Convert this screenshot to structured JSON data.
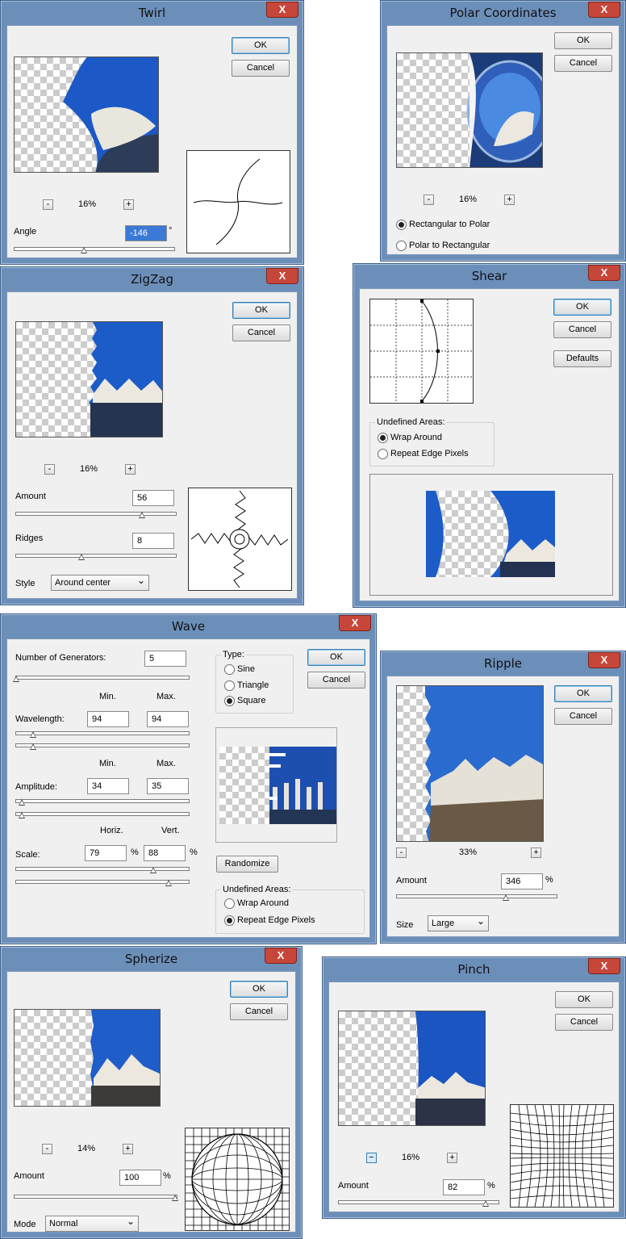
{
  "twirl": {
    "title": "Twirl",
    "ok": "OK",
    "cancel": "Cancel",
    "zoom": "16%",
    "minus": "-",
    "plus": "+",
    "angle_label": "Angle",
    "angle_value": "-146",
    "deg": "°"
  },
  "polar": {
    "title": "Polar Coordinates",
    "ok": "OK",
    "cancel": "Cancel",
    "zoom": "16%",
    "minus": "-",
    "plus": "+",
    "opt1": "Rectangular to Polar",
    "opt2": "Polar to Rectangular"
  },
  "zigzag": {
    "title": "ZigZag",
    "ok": "OK",
    "cancel": "Cancel",
    "zoom": "16%",
    "minus": "-",
    "plus": "+",
    "amount_label": "Amount",
    "amount_value": "56",
    "ridges_label": "Ridges",
    "ridges_value": "8",
    "style_label": "Style",
    "style_value": "Around center"
  },
  "shear": {
    "title": "Shear",
    "ok": "OK",
    "cancel": "Cancel",
    "defaults": "Defaults",
    "group": "Undefined Areas:",
    "opt1": "Wrap Around",
    "opt2": "Repeat Edge Pixels"
  },
  "wave": {
    "title": "Wave",
    "ok": "OK",
    "cancel": "Cancel",
    "gen_label": "Number of Generators:",
    "gen_value": "5",
    "type_label": "Type:",
    "type1": "Sine",
    "type2": "Triangle",
    "type3": "Square",
    "min1": "Min.",
    "max1": "Max.",
    "wl_label": "Wavelength:",
    "wl_min": "94",
    "wl_max": "94",
    "min2": "Min.",
    "max2": "Max.",
    "amp_label": "Amplitude:",
    "amp_min": "34",
    "amp_max": "35",
    "horiz": "Horiz.",
    "vert": "Vert.",
    "scale_label": "Scale:",
    "scale_h": "79",
    "scale_v": "88",
    "pct1": "%",
    "pct2": "%",
    "randomize": "Randomize",
    "group": "Undefined Areas:",
    "opt1": "Wrap Around",
    "opt2": "Repeat Edge Pixels"
  },
  "ripple": {
    "title": "Ripple",
    "ok": "OK",
    "cancel": "Cancel",
    "zoom": "33%",
    "minus": "-",
    "plus": "+",
    "amount_label": "Amount",
    "amount_value": "346",
    "pct": "%",
    "size_label": "Size",
    "size_value": "Large"
  },
  "spherize": {
    "title": "Spherize",
    "ok": "OK",
    "cancel": "Cancel",
    "zoom": "14%",
    "minus": "-",
    "plus": "+",
    "amount_label": "Amount",
    "amount_value": "100",
    "pct": "%",
    "mode_label": "Mode",
    "mode_value": "Normal"
  },
  "pinch": {
    "title": "Pinch",
    "ok": "OK",
    "cancel": "Cancel",
    "zoom": "16%",
    "minus": "−",
    "plus": "+",
    "amount_label": "Amount",
    "amount_value": "82",
    "pct": "%"
  },
  "close_glyph": "X",
  "colors": {
    "frame": "#6c8fba",
    "close": "#c7463a",
    "client": "#f0f0f0",
    "sky": "#1f5fcf"
  }
}
